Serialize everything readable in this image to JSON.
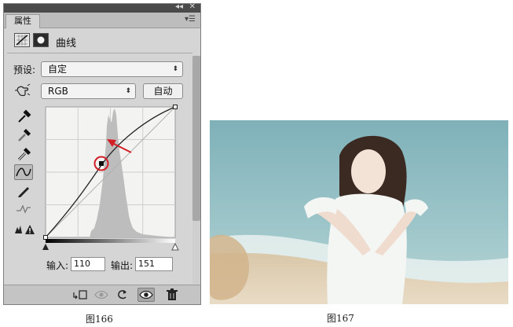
{
  "panel": {
    "tab_label": "属性",
    "title": "曲线",
    "preset_label": "预设:",
    "preset_value": "自定",
    "channel_value": "RGB",
    "auto_button": "自动",
    "input_label": "输入:",
    "input_value": "110",
    "output_label": "输出:",
    "output_value": "151"
  },
  "captions": {
    "left": "图166",
    "right": "图167"
  },
  "curve": {
    "control_point": {
      "input": 110,
      "output": 151
    },
    "range": [
      0,
      255
    ]
  },
  "colors": {
    "panel_bg": "#d5d5d5",
    "title_bar": "#4a4a4a",
    "annotation_red": "#d21f26"
  },
  "icons": [
    "curves-adjust-icon",
    "mask-icon",
    "on-image-adjust-icon",
    "black-eyedropper-icon",
    "gray-eyedropper-icon",
    "white-eyedropper-icon",
    "curve-edit-icon",
    "pencil-icon",
    "smooth-icon",
    "clipping-warning-icon",
    "clip-to-layer-icon",
    "view-previous-icon",
    "reset-icon",
    "visibility-eye-icon",
    "trash-icon"
  ]
}
